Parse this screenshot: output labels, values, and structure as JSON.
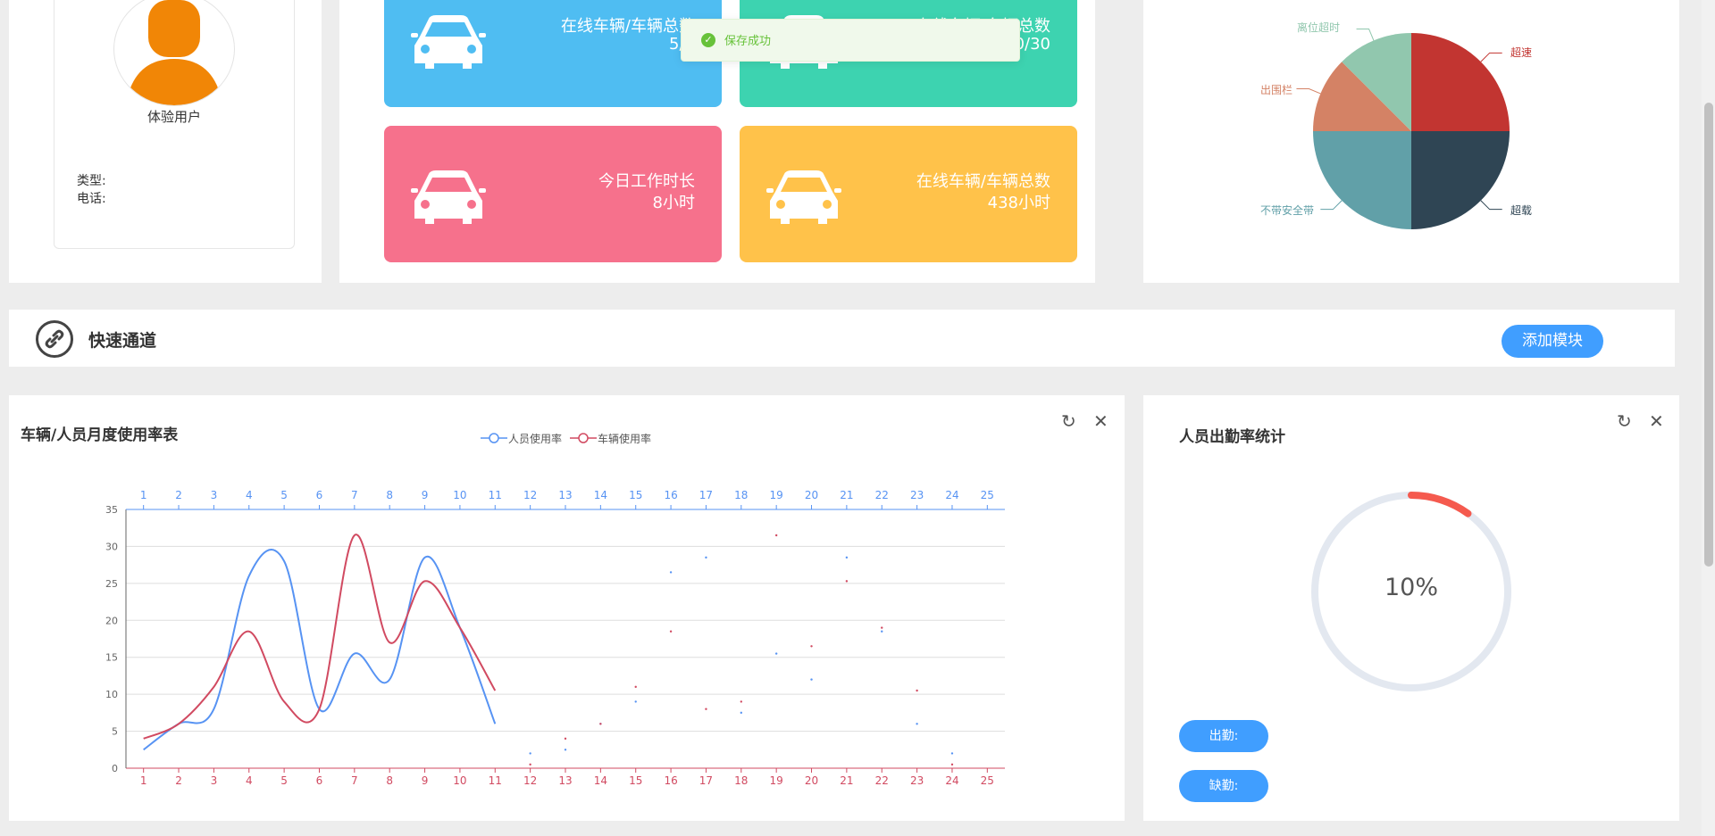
{
  "profile": {
    "name": "体验用户",
    "type_label": "类型:",
    "phone_label": "电话:"
  },
  "stats": [
    {
      "label": "在线车辆/车辆总数",
      "value": "5/7",
      "color": "#4fbdf2"
    },
    {
      "label": "在线车辆/车辆总数",
      "value": "10/30",
      "color": "#3dd3b0"
    },
    {
      "label": "今日工作时长",
      "value": "8小时",
      "color": "#f6718c"
    },
    {
      "label": "在线车辆/车辆总数",
      "value": "438小时",
      "color": "#ffc24a"
    }
  ],
  "toast": {
    "message": "保存成功"
  },
  "pie": {
    "labels": {
      "overspeed": "超速",
      "overload": "超载",
      "no_seatbelt": "不带安全带",
      "out_of_fence": "出围栏",
      "away_timeout": "离位超时"
    }
  },
  "quick_access": {
    "title": "快速通道",
    "add_button": "添加模块"
  },
  "usage_chart": {
    "title": "车辆/人员月度使用率表",
    "legend": [
      "人员使用率",
      "车辆使用率"
    ]
  },
  "attendance": {
    "title": "人员出勤率统计",
    "percent_text": "10%",
    "present_button": "出勤:",
    "absent_button": "缺勤:"
  },
  "chart_data": [
    {
      "type": "pie",
      "categories": [
        "超速",
        "超载",
        "不带安全带",
        "出围栏",
        "离位超时"
      ],
      "values": [
        25,
        25,
        25,
        12.5,
        12.5
      ],
      "colors": [
        "#c23531",
        "#2f4554",
        "#61a0a8",
        "#d48265",
        "#91c7ae"
      ]
    },
    {
      "type": "line",
      "title": "车辆/人员月度使用率表",
      "x": [
        1,
        2,
        3,
        4,
        5,
        6,
        7,
        8,
        9,
        10,
        11,
        12,
        13,
        14,
        15,
        16,
        17,
        18,
        19,
        20,
        21,
        22,
        23,
        24,
        25
      ],
      "ylim": [
        0,
        35
      ],
      "yticks": [
        0,
        5,
        10,
        15,
        20,
        25,
        30,
        35
      ],
      "series": [
        {
          "name": "人员使用率",
          "color": "#5793f3",
          "values": [
            2.5,
            6,
            8,
            26,
            28,
            8,
            15.5,
            12,
            28.5,
            19,
            6,
            2,
            2.5,
            6,
            9,
            26.5,
            28.5,
            7.5,
            15.5,
            12,
            28.5,
            18.5,
            6,
            2,
            null
          ]
        },
        {
          "name": "车辆使用率",
          "color": "#d14a61",
          "values": [
            4,
            6,
            11,
            18.5,
            9,
            8,
            31.5,
            17,
            25.3,
            19,
            10.5,
            0.5,
            4,
            6,
            11,
            18.5,
            8,
            9,
            31.5,
            16.5,
            25.3,
            19,
            10.5,
            0.5,
            null
          ]
        }
      ]
    },
    {
      "type": "gauge",
      "title": "人员出勤率统计",
      "value": 10,
      "max": 100,
      "color": "#f55a4e",
      "track_color": "#e3e8f0"
    }
  ]
}
